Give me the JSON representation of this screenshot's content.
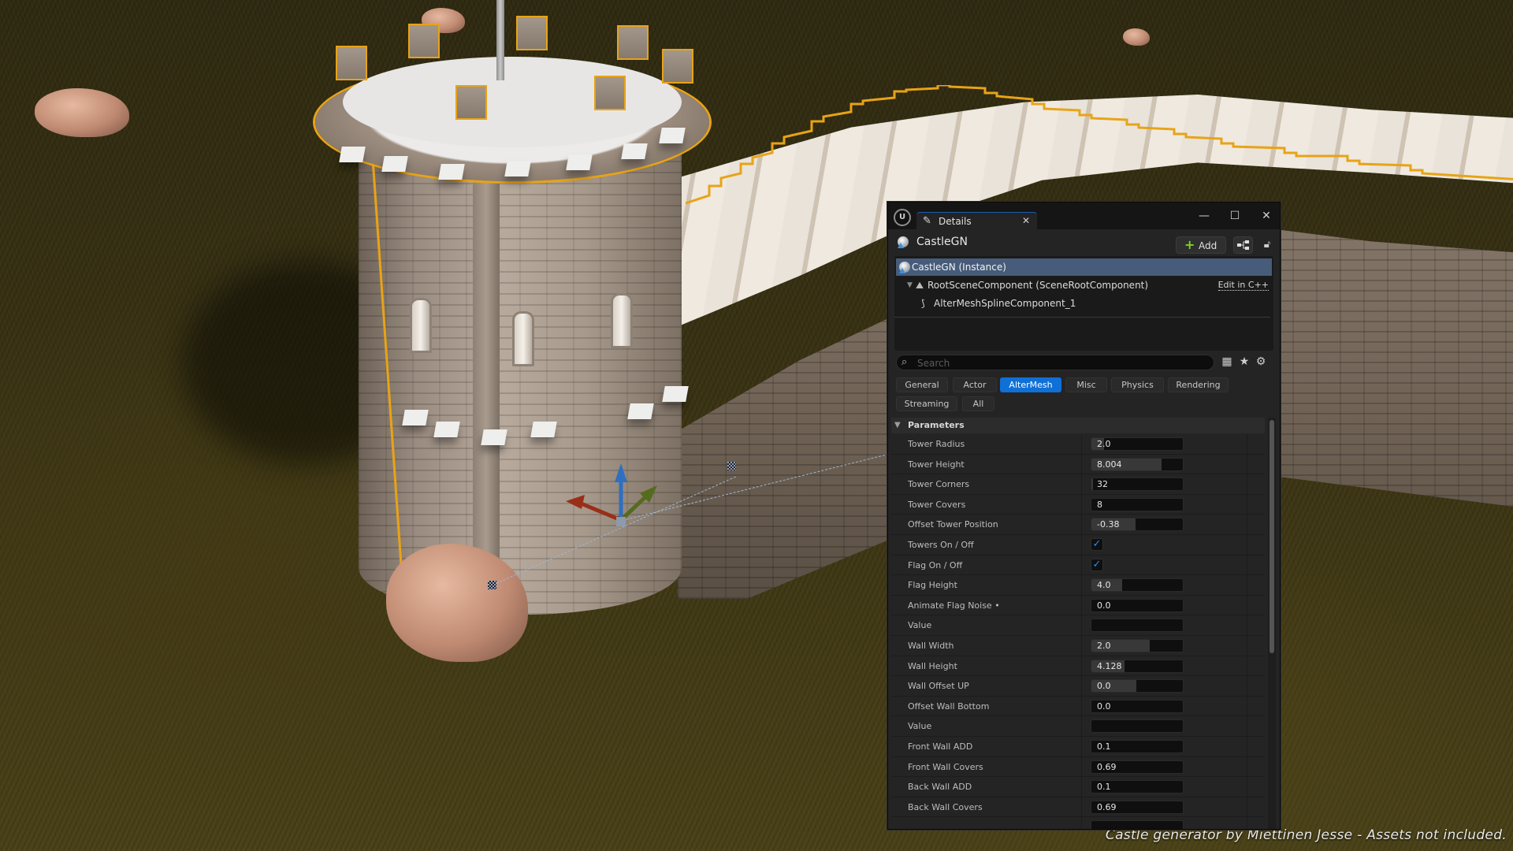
{
  "viewport": {
    "caption": "Castle generator by Miettinen Jesse - Assets not included.",
    "selection_color": "#e8a316",
    "gizmo_axes": {
      "x": "#b23a1e",
      "y": "#6f9a2c",
      "z": "#2f6fc0"
    }
  },
  "details": {
    "tab_label": "Details",
    "tab_icon": "pencil-details-icon",
    "window_buttons": {
      "minimize": "—",
      "maximize": "☐",
      "close": "✕"
    },
    "actor_name": "CastleGN",
    "add_button_label": "Add",
    "edit_cpp_label": "Edit in C++",
    "components": [
      {
        "label": "CastleGN (Instance)",
        "selected": true,
        "icon": "actor-instance-icon"
      },
      {
        "label": "RootSceneComponent (SceneRootComponent)",
        "selected": false,
        "icon": "scene-root-icon"
      },
      {
        "label": "AlterMeshSplineComponent_1",
        "selected": false,
        "icon": "spline-component-icon"
      }
    ],
    "search": {
      "placeholder": "Search",
      "value": ""
    },
    "categories": [
      {
        "label": "General",
        "active": false
      },
      {
        "label": "Actor",
        "active": false
      },
      {
        "label": "AlterMesh",
        "active": true
      },
      {
        "label": "Misc",
        "active": false
      },
      {
        "label": "Physics",
        "active": false
      },
      {
        "label": "Rendering",
        "active": false
      },
      {
        "label": "Streaming",
        "active": false
      },
      {
        "label": "All",
        "active": false
      }
    ],
    "section_title": "Parameters",
    "accent_color": "#0f70d7",
    "properties": [
      {
        "label": "Tower Radius",
        "type": "number",
        "value": "2.0",
        "slider_fraction": 0.14
      },
      {
        "label": "Tower Height",
        "type": "number",
        "value": "8.004",
        "slider_fraction": 0.77
      },
      {
        "label": "Tower Corners",
        "type": "number",
        "value": "32",
        "slider_fraction": 0.02
      },
      {
        "label": "Tower Covers",
        "type": "number",
        "value": "8",
        "slider_fraction": 0
      },
      {
        "label": "Offset Tower Position",
        "type": "number",
        "value": "-0.38",
        "slider_fraction": 0.48
      },
      {
        "label": "Towers On / Off",
        "type": "checkbox",
        "checked": true
      },
      {
        "label": "Flag On / Off",
        "type": "checkbox",
        "checked": true
      },
      {
        "label": "Flag Height",
        "type": "number",
        "value": "4.0",
        "slider_fraction": 0.34
      },
      {
        "label": "Animate Flag Noise •",
        "type": "number",
        "value": "0.0",
        "slider_fraction": 0
      },
      {
        "label": "Value",
        "type": "number",
        "value": "",
        "slider_fraction": 0
      },
      {
        "label": "Wall Width",
        "type": "number",
        "value": "2.0",
        "slider_fraction": 0.64
      },
      {
        "label": "Wall Height",
        "type": "number",
        "value": "4.128",
        "slider_fraction": 0.36
      },
      {
        "label": "Wall Offset UP",
        "type": "number",
        "value": "0.0",
        "slider_fraction": 0.49
      },
      {
        "label": "Offset Wall Bottom",
        "type": "number",
        "value": "0.0",
        "slider_fraction": 0
      },
      {
        "label": "Value",
        "type": "number",
        "value": "",
        "slider_fraction": 0
      },
      {
        "label": "Front Wall ADD",
        "type": "number",
        "value": "0.1",
        "slider_fraction": 0
      },
      {
        "label": "Front Wall Covers",
        "type": "number",
        "value": "0.69",
        "slider_fraction": 0
      },
      {
        "label": "Back Wall ADD",
        "type": "number",
        "value": "0.1",
        "slider_fraction": 0
      },
      {
        "label": "Back Wall Covers",
        "type": "number",
        "value": "0.69",
        "slider_fraction": 0
      },
      {
        "label": "",
        "type": "number",
        "value": "",
        "slider_fraction": 0
      }
    ],
    "scroll_fraction_visible": 0.57
  }
}
